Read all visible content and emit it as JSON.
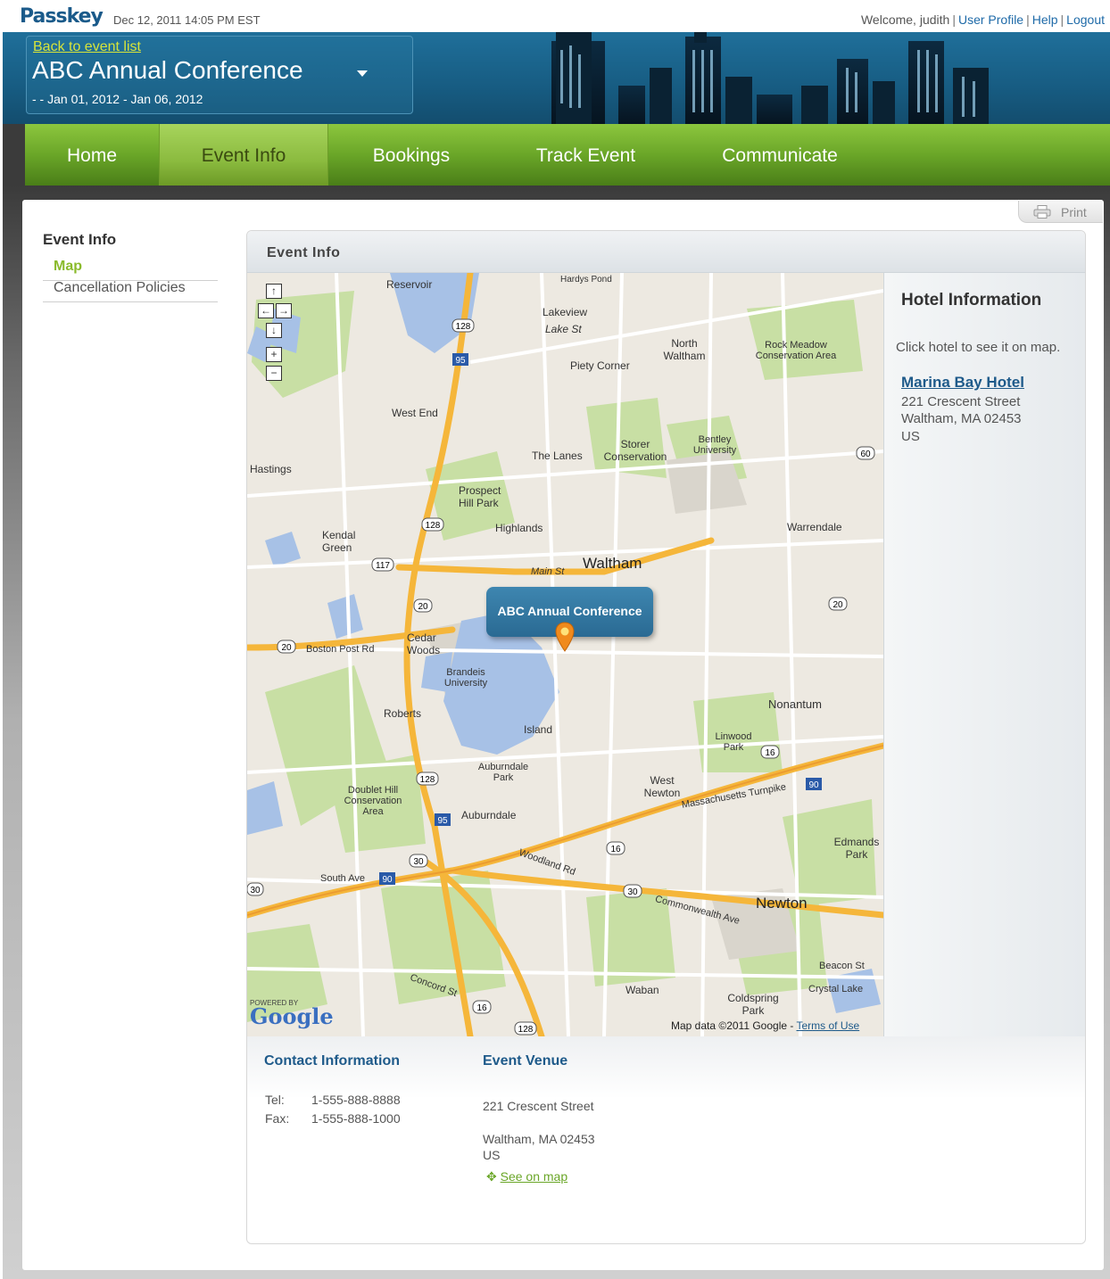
{
  "header": {
    "logo": "Passkey",
    "datetime": "Dec 12, 2011 14:05 PM EST",
    "welcome": "Welcome, judith",
    "links": [
      "User Profile",
      "Help",
      "Logout"
    ]
  },
  "event": {
    "back_link": "Back to event list",
    "title": "ABC Annual Conference",
    "dates": "- - Jan 01, 2012 - Jan 06, 2012"
  },
  "nav": {
    "items": [
      "Home",
      "Event Info",
      "Bookings",
      "Track Event",
      "Communicate"
    ],
    "active": "Event Info"
  },
  "print_label": "Print",
  "sidebar": {
    "title": "Event Info",
    "items": [
      "Map",
      "Cancellation Policies"
    ],
    "active": "Map"
  },
  "panel": {
    "title": "Event Info"
  },
  "map": {
    "callout": "ABC Annual Conference",
    "copyright": "Map data ©2011 Google - ",
    "terms": "Terms of Use",
    "powered_by": "POWERED BY",
    "google": "Google",
    "controls": [
      "↑",
      "←",
      "→",
      "↓",
      "+",
      "−"
    ],
    "labels": [
      "Reservoir",
      "Hardys Pond",
      "Lakeview",
      "Lake St",
      "Piety Corner",
      "North Waltham",
      "Rock Meadow Conservation Area",
      "West End",
      "Storer Conservation",
      "Bentley University",
      "The Lanes",
      "Hastings",
      "Prospect Hill Park",
      "Highlands",
      "Kendal Green",
      "Waltham",
      "Main St",
      "Warrendale",
      "Cedar Woods",
      "Brandeis University",
      "Roberts",
      "Island",
      "Nonantum",
      "Linwood Park",
      "Auburndale Park",
      "West Newton",
      "Doublet Hill Conservation Area",
      "Auburndale",
      "South Ave",
      "Edmands Park",
      "Newton",
      "Waban",
      "Coldspring Park",
      "Crystal Lake",
      "Beacon St",
      "Boston Post Rd",
      "Massachusetts Turnpike",
      "Commonwealth Ave",
      "Woodland Rd",
      "Concord St"
    ],
    "colors": {
      "road_major": "#f5b63a",
      "road_minor": "#ffffff",
      "water": "#a7c1e6",
      "park": "#c8dfa4",
      "land": "#ede9e1"
    }
  },
  "hotel_info": {
    "title": "Hotel Information",
    "hint": "Click hotel to see it on map.",
    "hotel_name": "Marina Bay Hotel",
    "address1": "221 Crescent Street",
    "address2": "Waltham, MA 02453",
    "country": "US"
  },
  "contact": {
    "title": "Contact Information",
    "tel_label": "Tel:",
    "tel": "1-555-888-8888",
    "fax_label": "Fax:",
    "fax": "1-555-888-1000"
  },
  "venue": {
    "title": "Event Venue",
    "street": "221 Crescent Street",
    "city": "Waltham, MA 02453",
    "country": "US",
    "see_on_map": "See on map"
  },
  "colors": {
    "brand_blue": "#1e5a8a",
    "nav_green": "#6aa628",
    "active_green": "#8aba2b",
    "link_yellow": "#d7e43a"
  }
}
